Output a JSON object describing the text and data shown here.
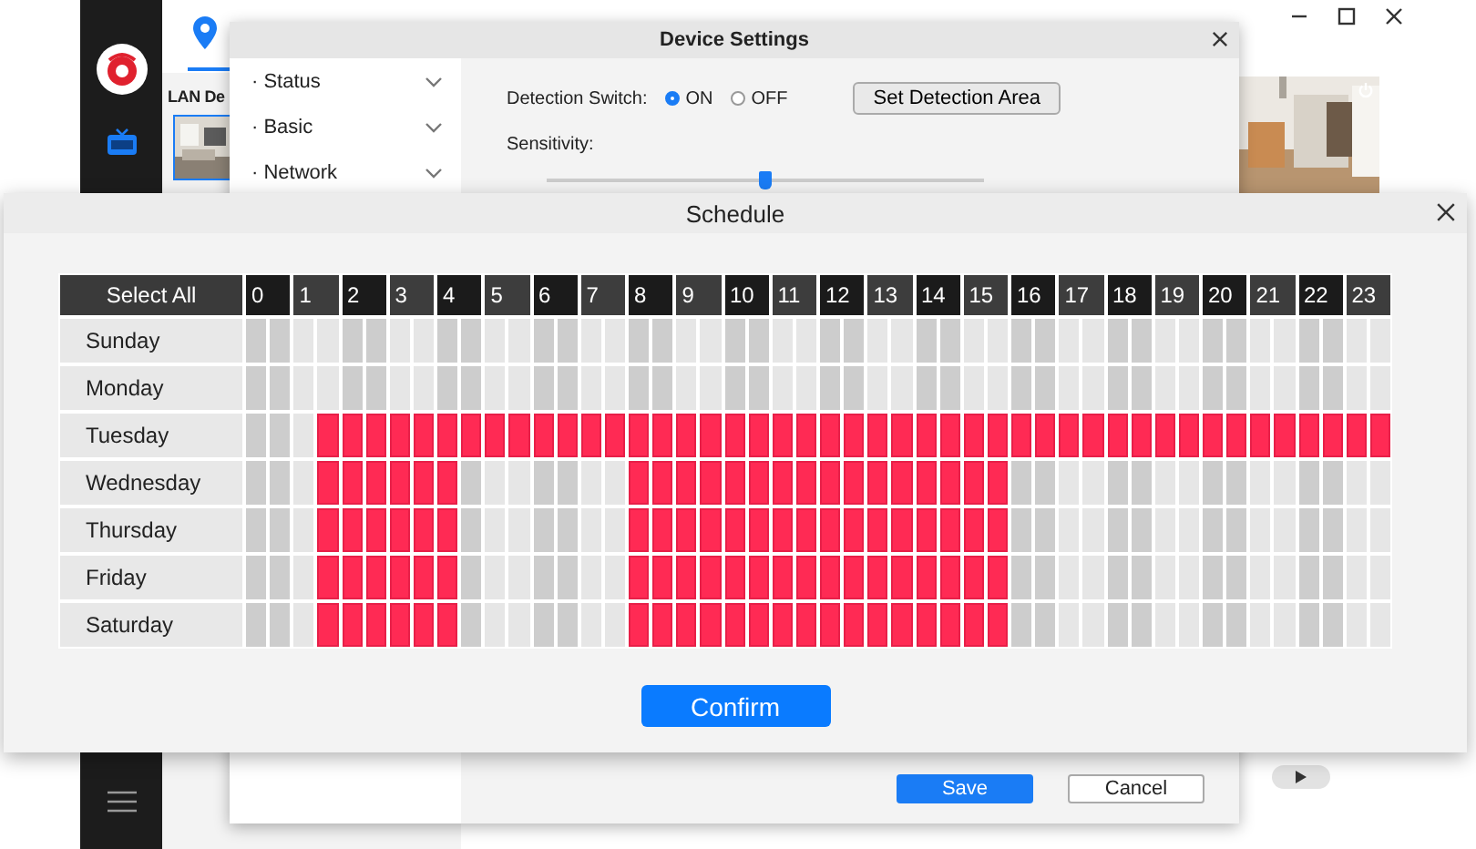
{
  "app": {
    "lan_label": "LAN De"
  },
  "device_settings": {
    "title": "Device Settings",
    "menu": [
      {
        "label": "· Status"
      },
      {
        "label": "· Basic"
      },
      {
        "label": "· Network"
      }
    ],
    "detection_label": "Detection Switch:",
    "detection_options": [
      {
        "label": "ON",
        "selected": true
      },
      {
        "label": "OFF",
        "selected": false
      }
    ],
    "set_area_button": "Set Detection Area",
    "sensitivity_label": "Sensitivity:",
    "sensitivity": {
      "level": 0.5
    },
    "save": "Save",
    "cancel": "Cancel"
  },
  "schedule": {
    "title": "Schedule",
    "select_all": "Select All",
    "hours": [
      "0",
      "1",
      "2",
      "3",
      "4",
      "5",
      "6",
      "7",
      "8",
      "9",
      "10",
      "11",
      "12",
      "13",
      "14",
      "15",
      "16",
      "17",
      "18",
      "19",
      "20",
      "21",
      "22",
      "23"
    ],
    "days": [
      {
        "name": "Sunday",
        "slots": [
          false,
          false,
          false,
          false,
          false,
          false,
          false,
          false,
          false,
          false,
          false,
          false,
          false,
          false,
          false,
          false,
          false,
          false,
          false,
          false,
          false,
          false,
          false,
          false,
          false,
          false,
          false,
          false,
          false,
          false,
          false,
          false,
          false,
          false,
          false,
          false,
          false,
          false,
          false,
          false,
          false,
          false,
          false,
          false,
          false,
          false,
          false,
          false
        ]
      },
      {
        "name": "Monday",
        "slots": [
          false,
          false,
          false,
          false,
          false,
          false,
          false,
          false,
          false,
          false,
          false,
          false,
          false,
          false,
          false,
          false,
          false,
          false,
          false,
          false,
          false,
          false,
          false,
          false,
          false,
          false,
          false,
          false,
          false,
          false,
          false,
          false,
          false,
          false,
          false,
          false,
          false,
          false,
          false,
          false,
          false,
          false,
          false,
          false,
          false,
          false,
          false,
          false
        ]
      },
      {
        "name": "Tuesday",
        "slots": [
          false,
          false,
          false,
          true,
          true,
          true,
          true,
          true,
          true,
          true,
          true,
          true,
          true,
          true,
          true,
          true,
          true,
          true,
          true,
          true,
          true,
          true,
          true,
          true,
          true,
          true,
          true,
          true,
          true,
          true,
          true,
          true,
          true,
          true,
          true,
          true,
          true,
          true,
          true,
          true,
          true,
          true,
          true,
          true,
          true,
          true,
          true,
          true
        ]
      },
      {
        "name": "Wednesday",
        "slots": [
          false,
          false,
          false,
          true,
          true,
          true,
          true,
          true,
          true,
          false,
          false,
          false,
          false,
          false,
          false,
          false,
          true,
          true,
          true,
          true,
          true,
          true,
          true,
          true,
          true,
          true,
          true,
          true,
          true,
          true,
          true,
          true,
          false,
          false,
          false,
          false,
          false,
          false,
          false,
          false,
          false,
          false,
          false,
          false,
          false,
          false,
          false,
          false
        ]
      },
      {
        "name": "Thursday",
        "slots": [
          false,
          false,
          false,
          true,
          true,
          true,
          true,
          true,
          true,
          false,
          false,
          false,
          false,
          false,
          false,
          false,
          true,
          true,
          true,
          true,
          true,
          true,
          true,
          true,
          true,
          true,
          true,
          true,
          true,
          true,
          true,
          true,
          false,
          false,
          false,
          false,
          false,
          false,
          false,
          false,
          false,
          false,
          false,
          false,
          false,
          false,
          false,
          false
        ]
      },
      {
        "name": "Friday",
        "slots": [
          false,
          false,
          false,
          true,
          true,
          true,
          true,
          true,
          true,
          false,
          false,
          false,
          false,
          false,
          false,
          false,
          true,
          true,
          true,
          true,
          true,
          true,
          true,
          true,
          true,
          true,
          true,
          true,
          true,
          true,
          true,
          true,
          false,
          false,
          false,
          false,
          false,
          false,
          false,
          false,
          false,
          false,
          false,
          false,
          false,
          false,
          false,
          false
        ]
      },
      {
        "name": "Saturday",
        "slots": [
          false,
          false,
          false,
          true,
          true,
          true,
          true,
          true,
          true,
          false,
          false,
          false,
          false,
          false,
          false,
          false,
          true,
          true,
          true,
          true,
          true,
          true,
          true,
          true,
          true,
          true,
          true,
          true,
          true,
          true,
          true,
          true,
          false,
          false,
          false,
          false,
          false,
          false,
          false,
          false,
          false,
          false,
          false,
          false,
          false,
          false,
          false,
          false
        ]
      }
    ],
    "confirm": "Confirm"
  }
}
